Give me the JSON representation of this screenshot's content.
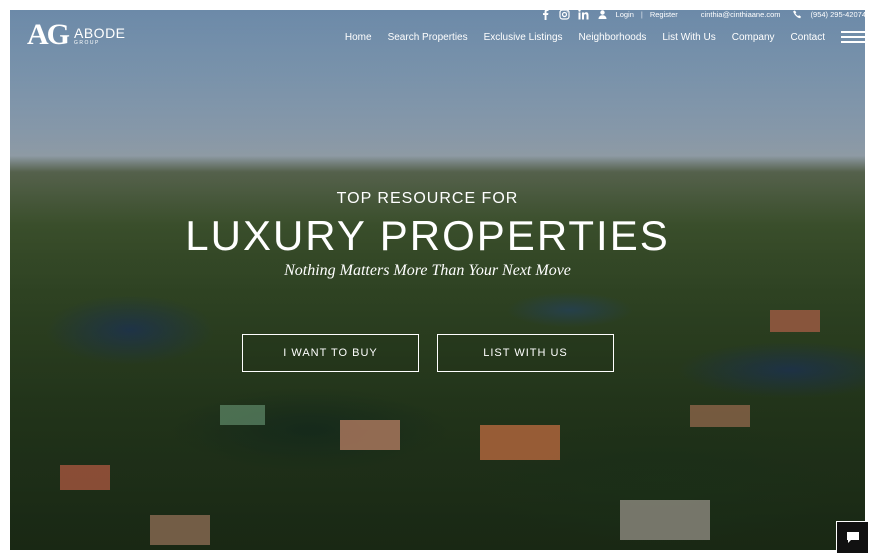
{
  "topbar": {
    "login": "Login",
    "divider": "|",
    "register": "Register",
    "email": "cinthia@cinthiaane.com",
    "phone": "(954) 295-42074"
  },
  "logo": {
    "monogram": "AG",
    "name": "ABODE",
    "sub": "GROUP"
  },
  "nav": {
    "items": [
      "Home",
      "Search Properties",
      "Exclusive Listings",
      "Neighborhoods",
      "List With Us",
      "Company",
      "Contact"
    ]
  },
  "hero": {
    "pre": "TOP RESOURCE FOR",
    "title": "LUXURY PROPERTIES",
    "tagline": "Nothing Matters More Than Your Next Move",
    "buy_button": "I WANT TO BUY",
    "list_button": "LIST WITH US"
  },
  "icons": [
    "facebook-icon",
    "instagram-icon",
    "linkedin-icon",
    "user-icon",
    "phone-icon",
    "menu-icon",
    "chat-icon"
  ]
}
